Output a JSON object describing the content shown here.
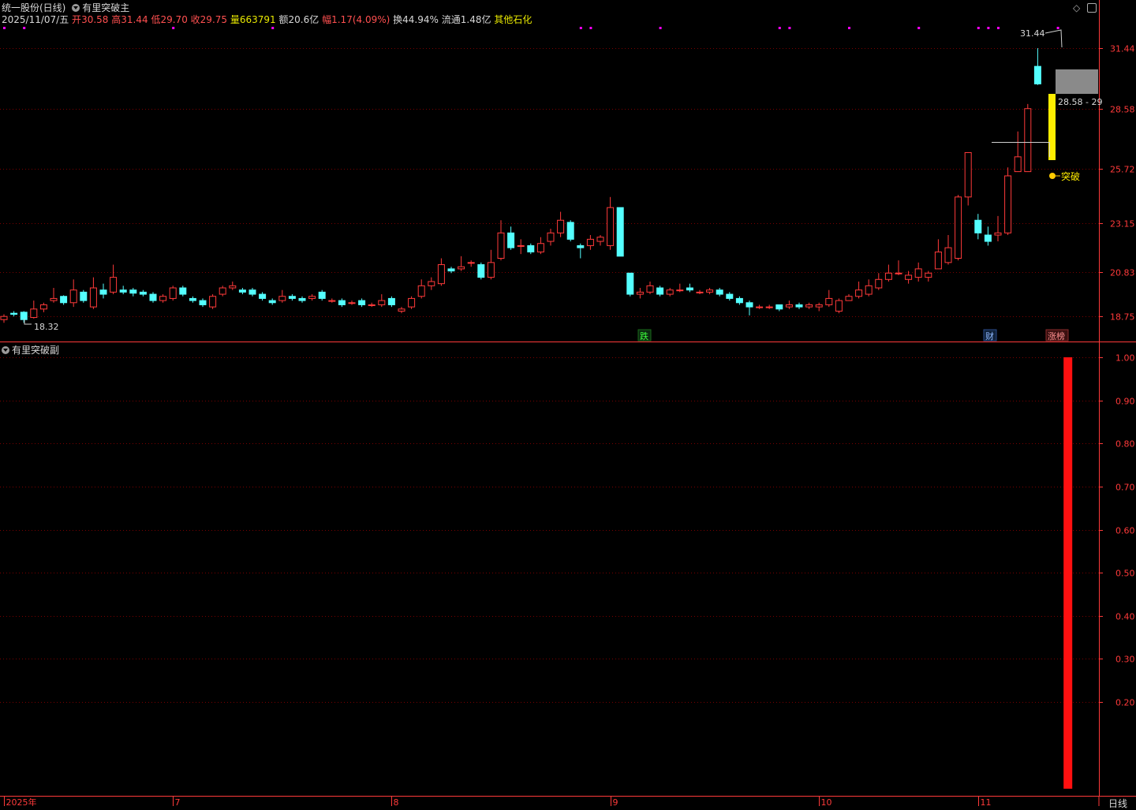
{
  "header": {
    "stock_name": "统一股份(日线)",
    "main_indicator": "有里突破主",
    "date": "2025/11/07/五",
    "open_label": "开",
    "open": "30.58",
    "high_label": "高",
    "high": "31.44",
    "low_label": "低",
    "low": "29.70",
    "close_label": "收",
    "close": "29.75",
    "volume_label": "量",
    "volume": "663791",
    "amount_label": "额",
    "amount": "20.6亿",
    "change_label": "幅",
    "change": "1.17(4.09%)",
    "turnover_label": "换",
    "turnover": "44.94%",
    "float_label": "流通",
    "float": "1.48亿",
    "industry": "其他石化"
  },
  "sub_panel": {
    "title": "有里突破副"
  },
  "annotations": {
    "high_value": "31.44",
    "low_value": "18.32",
    "range_label": "28.58 - 29",
    "breakout_label": "突破",
    "tag_fall": "跌",
    "tag_finance": "财",
    "tag_list": "涨榜"
  },
  "bottom_bar": {
    "period": "日线"
  },
  "colors": {
    "up": "#ff3a3a",
    "down": "#54ffff",
    "grid": "#7a0000",
    "axis": "#ff3a3a",
    "signal": "#ffff00",
    "magenta": "#ff00ff"
  },
  "chart_data": [
    {
      "type": "candlestick",
      "title": "",
      "y_axis_ticks": [
        31.44,
        28.58,
        25.72,
        23.15,
        20.83,
        18.75
      ],
      "ylim": [
        17.75,
        32.6
      ],
      "x_axis_labels": [
        {
          "label": "2025年",
          "index": 0
        },
        {
          "label": "7",
          "index": 17
        },
        {
          "label": "8",
          "index": 39
        },
        {
          "label": "9",
          "index": 61
        },
        {
          "label": "10",
          "index": 82
        },
        {
          "label": "11",
          "index": 98
        }
      ],
      "candles": [
        [
          18.6,
          18.75,
          18.85,
          18.45
        ],
        [
          18.9,
          18.85,
          19.0,
          18.75
        ],
        [
          18.95,
          18.6,
          19.0,
          18.45
        ],
        [
          18.7,
          19.1,
          19.5,
          18.65
        ],
        [
          19.1,
          19.3,
          19.4,
          18.95
        ],
        [
          19.5,
          19.6,
          20.1,
          19.4
        ],
        [
          19.7,
          19.4,
          19.75,
          19.3
        ],
        [
          19.4,
          20.0,
          20.5,
          19.2
        ],
        [
          19.9,
          19.5,
          20.0,
          19.4
        ],
        [
          19.2,
          20.1,
          20.6,
          19.1
        ],
        [
          20.0,
          19.8,
          20.3,
          19.6
        ],
        [
          19.9,
          20.6,
          21.2,
          19.8
        ],
        [
          20.0,
          19.9,
          20.2,
          19.8
        ],
        [
          20.0,
          19.85,
          20.1,
          19.7
        ],
        [
          19.9,
          19.8,
          20.0,
          19.7
        ],
        [
          19.8,
          19.5,
          19.9,
          19.4
        ],
        [
          19.5,
          19.7,
          19.8,
          19.4
        ],
        [
          19.6,
          20.1,
          20.2,
          19.5
        ],
        [
          20.1,
          19.8,
          20.2,
          19.7
        ],
        [
          19.6,
          19.5,
          19.7,
          19.4
        ],
        [
          19.5,
          19.3,
          19.6,
          19.2
        ],
        [
          19.2,
          19.7,
          19.8,
          19.1
        ],
        [
          19.8,
          20.1,
          20.2,
          19.7
        ],
        [
          20.1,
          20.2,
          20.4,
          20.0
        ],
        [
          20.0,
          19.9,
          20.1,
          19.8
        ],
        [
          20.0,
          19.8,
          20.1,
          19.7
        ],
        [
          19.8,
          19.6,
          19.9,
          19.5
        ],
        [
          19.5,
          19.4,
          19.6,
          19.3
        ],
        [
          19.5,
          19.7,
          20.0,
          19.4
        ],
        [
          19.7,
          19.6,
          19.8,
          19.5
        ],
        [
          19.6,
          19.5,
          19.7,
          19.4
        ],
        [
          19.6,
          19.7,
          19.8,
          19.5
        ],
        [
          19.9,
          19.6,
          20.0,
          19.5
        ],
        [
          19.5,
          19.5,
          19.6,
          19.4
        ],
        [
          19.5,
          19.3,
          19.6,
          19.2
        ],
        [
          19.4,
          19.4,
          19.5,
          19.3
        ],
        [
          19.5,
          19.3,
          19.6,
          19.2
        ],
        [
          19.3,
          19.3,
          19.4,
          19.2
        ],
        [
          19.3,
          19.5,
          19.8,
          19.2
        ],
        [
          19.6,
          19.3,
          19.7,
          19.2
        ],
        [
          19.0,
          19.1,
          19.2,
          18.9
        ],
        [
          19.2,
          19.6,
          19.7,
          19.1
        ],
        [
          19.7,
          20.2,
          20.5,
          19.6
        ],
        [
          20.2,
          20.4,
          20.6,
          20.0
        ],
        [
          20.3,
          21.2,
          21.5,
          20.2
        ],
        [
          21.0,
          20.9,
          21.1,
          20.8
        ],
        [
          21.0,
          21.1,
          21.6,
          20.9
        ],
        [
          21.3,
          21.3,
          21.4,
          21.1
        ],
        [
          21.2,
          20.6,
          21.3,
          20.5
        ],
        [
          20.6,
          21.3,
          21.9,
          20.5
        ],
        [
          21.5,
          22.7,
          23.3,
          21.4
        ],
        [
          22.7,
          22.0,
          23.0,
          21.9
        ],
        [
          22.1,
          22.1,
          22.4,
          21.7
        ],
        [
          22.1,
          21.8,
          22.2,
          21.7
        ],
        [
          21.8,
          22.2,
          22.5,
          21.7
        ],
        [
          22.3,
          22.7,
          22.9,
          22.1
        ],
        [
          22.7,
          23.3,
          23.7,
          22.5
        ],
        [
          23.2,
          22.4,
          23.3,
          22.3
        ],
        [
          22.1,
          22.0,
          22.2,
          21.5
        ],
        [
          22.1,
          22.4,
          22.6,
          21.9
        ],
        [
          22.3,
          22.5,
          22.6,
          22.1
        ],
        [
          22.1,
          23.9,
          24.4,
          21.9
        ],
        [
          23.9,
          21.6,
          23.9,
          21.6
        ],
        [
          20.8,
          19.8,
          20.8,
          19.7
        ],
        [
          19.8,
          19.9,
          20.1,
          19.6
        ],
        [
          19.9,
          20.2,
          20.4,
          19.8
        ],
        [
          20.1,
          19.8,
          20.2,
          19.7
        ],
        [
          19.8,
          20.0,
          20.1,
          19.7
        ],
        [
          20.0,
          20.0,
          20.3,
          19.9
        ],
        [
          20.1,
          20.0,
          20.3,
          19.9
        ],
        [
          19.9,
          19.9,
          20.0,
          19.8
        ],
        [
          19.9,
          20.0,
          20.1,
          19.8
        ],
        [
          20.0,
          19.8,
          20.1,
          19.7
        ],
        [
          19.8,
          19.6,
          19.9,
          19.5
        ],
        [
          19.6,
          19.4,
          19.7,
          19.3
        ],
        [
          19.4,
          19.2,
          19.5,
          18.8
        ],
        [
          19.2,
          19.2,
          19.3,
          19.1
        ],
        [
          19.2,
          19.2,
          19.3,
          19.1
        ],
        [
          19.3,
          19.1,
          19.3,
          19.0
        ],
        [
          19.2,
          19.3,
          19.5,
          19.1
        ],
        [
          19.3,
          19.2,
          19.4,
          19.1
        ],
        [
          19.2,
          19.3,
          19.4,
          19.1
        ],
        [
          19.2,
          19.3,
          19.4,
          19.0
        ],
        [
          19.3,
          19.6,
          20.0,
          19.2
        ],
        [
          19.0,
          19.5,
          19.6,
          18.9
        ],
        [
          19.5,
          19.7,
          19.8,
          19.5
        ],
        [
          19.7,
          20.0,
          20.4,
          19.6
        ],
        [
          19.8,
          20.2,
          20.5,
          19.7
        ],
        [
          20.1,
          20.5,
          20.8,
          20.0
        ],
        [
          20.5,
          20.8,
          21.2,
          20.4
        ],
        [
          20.8,
          20.8,
          21.4,
          20.7
        ],
        [
          20.5,
          20.7,
          20.9,
          20.3
        ],
        [
          20.6,
          21.0,
          21.3,
          20.4
        ],
        [
          20.6,
          20.8,
          20.9,
          20.4
        ],
        [
          21.0,
          21.8,
          22.4,
          21.0
        ],
        [
          21.3,
          22.0,
          22.6,
          21.2
        ],
        [
          21.5,
          24.4,
          24.5,
          21.4
        ],
        [
          24.4,
          26.5,
          26.5,
          24.0
        ],
        [
          23.3,
          22.7,
          23.6,
          22.4
        ],
        [
          22.6,
          22.3,
          23.0,
          22.1
        ],
        [
          22.6,
          22.7,
          23.5,
          22.3
        ],
        [
          22.7,
          25.4,
          25.8,
          22.6
        ],
        [
          25.6,
          26.3,
          27.5,
          25.6
        ],
        [
          25.6,
          28.58,
          28.8,
          25.6
        ],
        [
          30.58,
          29.75,
          31.44,
          29.7
        ]
      ]
    },
    {
      "type": "bar",
      "title": "",
      "y_axis_ticks": [
        1.0,
        0.9,
        0.8,
        0.7,
        0.6,
        0.5,
        0.4,
        0.3,
        0.2
      ],
      "ylim": [
        0.11,
        1.03
      ],
      "bars": [
        {
          "index": 107,
          "value": 1.0
        }
      ]
    }
  ]
}
